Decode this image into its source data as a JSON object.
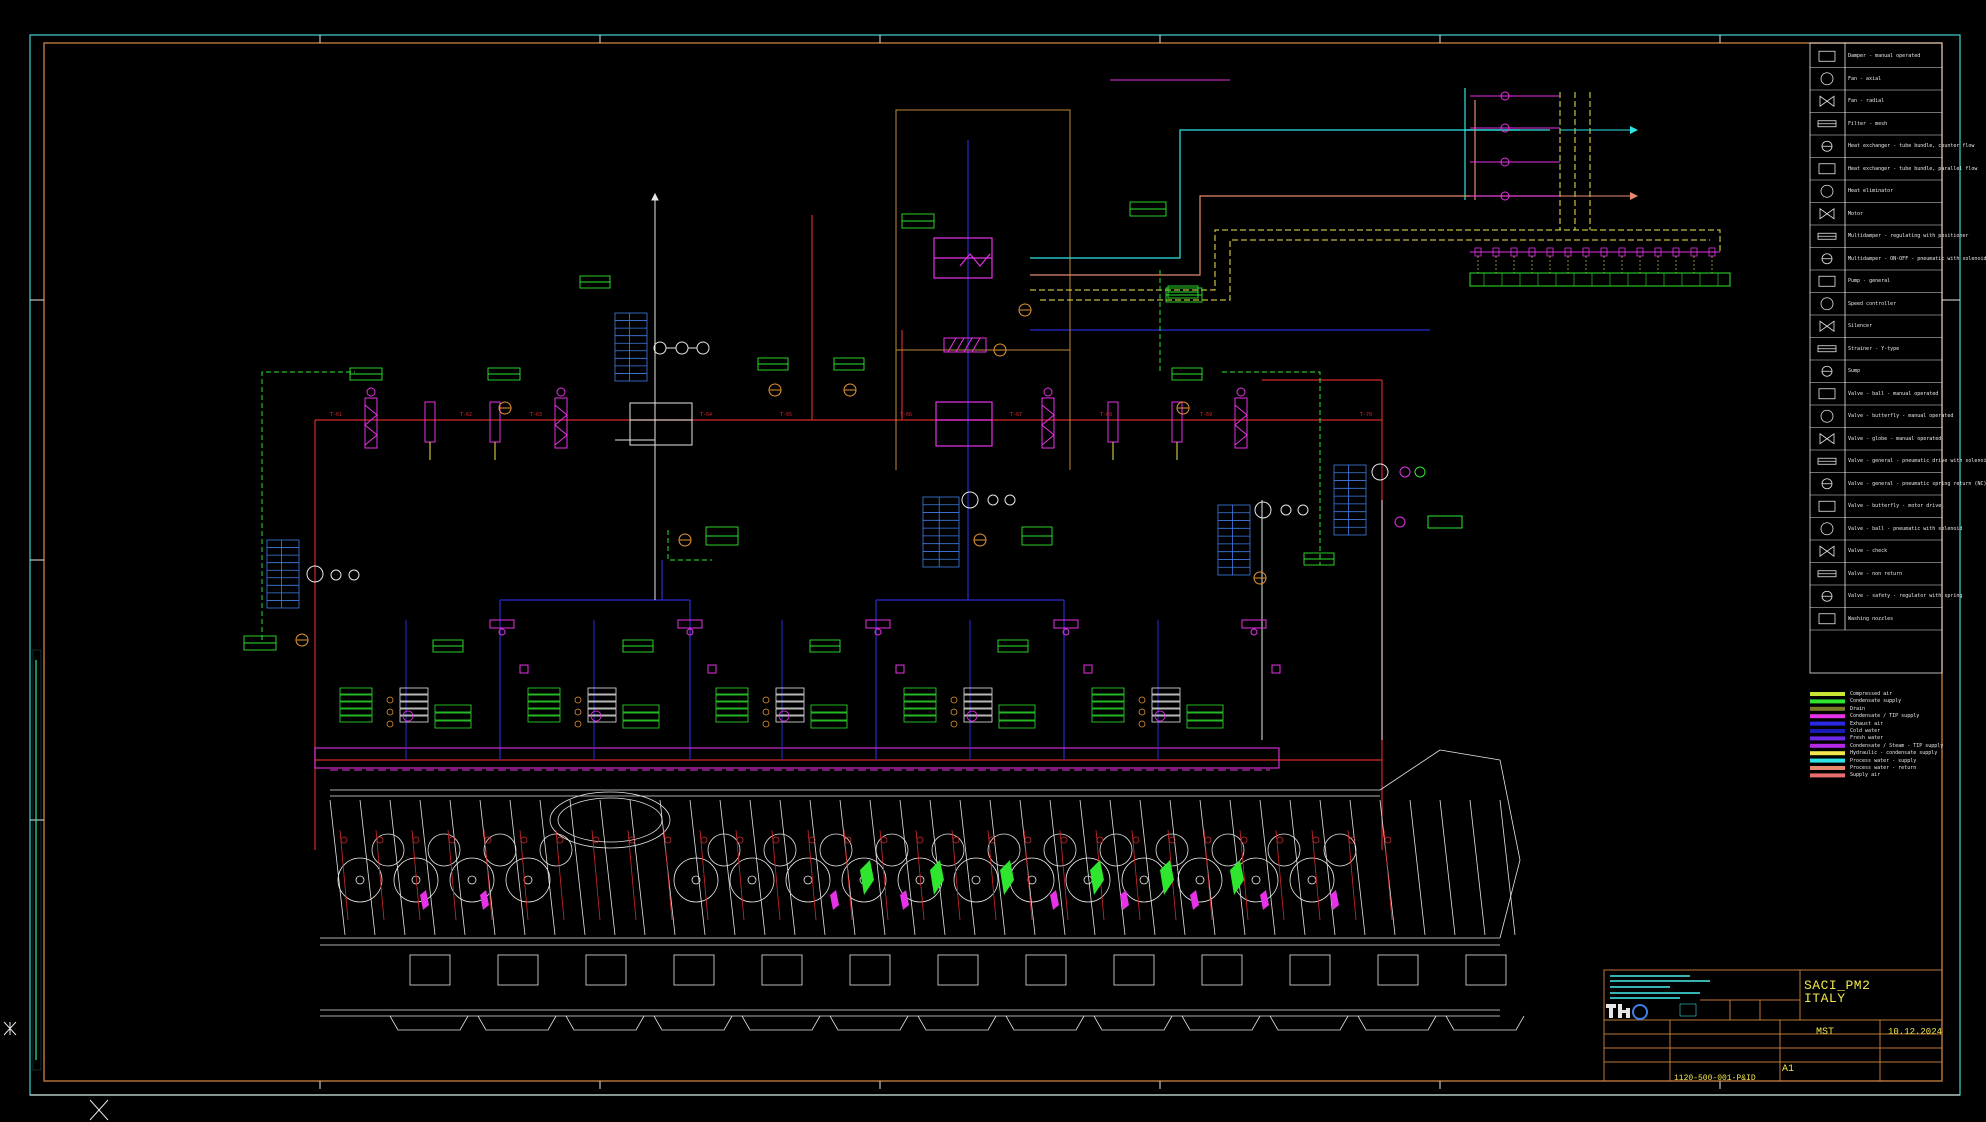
{
  "title_block": {
    "project": "SACI_PM2",
    "location": "ITALY",
    "drawn_by": "MST",
    "date": "10.12.2024",
    "sheet_size": "A1",
    "drawing_number": "1120-500-001-P&ID"
  },
  "legend_symbols": [
    {
      "icon": "damper-icon",
      "label": "Damper - manual operated"
    },
    {
      "icon": "fan-axial-icon",
      "label": "Fan - axial"
    },
    {
      "icon": "fan-radial-icon",
      "label": "Fan - radial"
    },
    {
      "icon": "filter-icon",
      "label": "Filter - mesh"
    },
    {
      "icon": "heat-exchanger-icon",
      "label": "Heat exchanger - tube bundle, counter flow"
    },
    {
      "icon": "heat-exchanger-parallel-icon",
      "label": "Heat exchanger - tube bundle, parallel flow"
    },
    {
      "icon": "heat-eliminator-icon",
      "label": "Heat eliminator"
    },
    {
      "icon": "motor-icon",
      "label": "Motor"
    },
    {
      "icon": "multidamper-icon",
      "label": "Multidamper - regulating with positioner"
    },
    {
      "icon": "multidamper-onoff-icon",
      "label": "Multidamper - ON-OFF - pneumatic with solenoid"
    },
    {
      "icon": "pump-icon",
      "label": "Pump - general"
    },
    {
      "icon": "speed-controller-icon",
      "label": "Speed controller"
    },
    {
      "icon": "silencer-icon",
      "label": "Silencer"
    },
    {
      "icon": "strainer-icon",
      "label": "Strainer - Y-type"
    },
    {
      "icon": "sump-icon",
      "label": "Sump"
    },
    {
      "icon": "valve-ball-icon",
      "label": "Valve - ball - manual operated"
    },
    {
      "icon": "valve-butterfly-icon",
      "label": "Valve - butterfly - manual operated"
    },
    {
      "icon": "valve-globe-icon",
      "label": "Valve - globe - manual operated"
    },
    {
      "icon": "valve-general-icon",
      "label": "Valve - general - pneumatic drive with solenoid and spring return (NC)"
    },
    {
      "icon": "valve-general-spring-icon",
      "label": "Valve - general - pneumatic spring return (NC) with positioner"
    },
    {
      "icon": "valve-butterfly-motor-icon",
      "label": "Valve - butterfly - motor drive"
    },
    {
      "icon": "valve-ball-pneumatic-icon",
      "label": "Valve - ball - pneumatic with solenoid"
    },
    {
      "icon": "valve-check-icon",
      "label": "Valve - check"
    },
    {
      "icon": "valve-nonreturn-icon",
      "label": "Valve - non return"
    },
    {
      "icon": "valve-safety-icon",
      "label": "Valve - safety - regulator with spring"
    },
    {
      "icon": "washing-nozzles-icon",
      "label": "Washing nozzles"
    }
  ],
  "legend_lines": [
    {
      "label": "Compressed air",
      "color": "#c8e632"
    },
    {
      "label": "Condensate supply",
      "color": "#2ee62e"
    },
    {
      "label": "Drain",
      "color": "#7a7a2a"
    },
    {
      "label": "Condensate / TIP supply",
      "color": "#e632e6"
    },
    {
      "label": "Exhaust air",
      "color": "#2a2ae6"
    },
    {
      "label": "Cold water",
      "color": "#1a1ab4"
    },
    {
      "label": "Fresh water",
      "color": "#6e2ae6"
    },
    {
      "label": "Condensate / Steam - TIP supply",
      "color": "#b42ae6"
    },
    {
      "label": "Hydraulic - condensate supply",
      "color": "#f2e64a"
    },
    {
      "label": "Process water - supply",
      "color": "#2ee6e6"
    },
    {
      "label": "Process water - return",
      "color": "#e68a6e"
    },
    {
      "label": "Supply air",
      "color": "#e66e6e"
    }
  ],
  "sensor_labels": [
    "T-61",
    "T-62",
    "T-63",
    "T-64",
    "T-65",
    "T-66",
    "T-67",
    "T-68",
    "T-69",
    "T-70"
  ],
  "colors": {
    "border": "#3fd3d3",
    "frame": "#c0783c",
    "supply": "#d22a2a",
    "exhaust": "#2a2ad2",
    "condensate": "#e632e6",
    "signal": "#2ee62e",
    "instrument": "#e69632",
    "machine": "#e6e6e6"
  }
}
